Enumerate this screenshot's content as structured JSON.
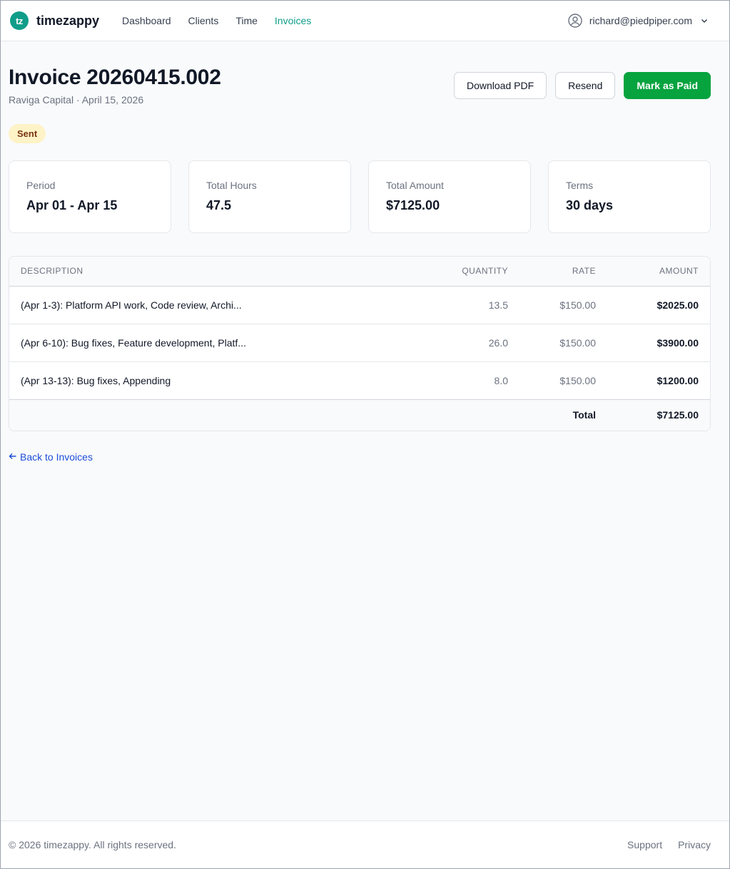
{
  "app": {
    "logo_text": "tz",
    "brand": "timezappy",
    "nav": [
      {
        "label": "Dashboard",
        "active": false
      },
      {
        "label": "Clients",
        "active": false
      },
      {
        "label": "Time",
        "active": false
      },
      {
        "label": "Invoices",
        "active": true
      }
    ],
    "user_email": "richard@piedpiper.com",
    "accent_color": "#0f9d8a"
  },
  "invoice": {
    "title": "Invoice 20260415.002",
    "subtitle": "Raviga Capital · April 15, 2026",
    "status": "Sent",
    "actions": {
      "download": "Download PDF",
      "resend": "Resend",
      "mark_paid": "Mark as Paid"
    }
  },
  "stats": [
    {
      "label": "Period",
      "value": "Apr 01 - Apr 15"
    },
    {
      "label": "Total Hours",
      "value": "47.5"
    },
    {
      "label": "Total Amount",
      "value": "$7125.00"
    },
    {
      "label": "Terms",
      "value": "30 days"
    }
  ],
  "table": {
    "headers": {
      "description": "DESCRIPTION",
      "quantity": "QUANTITY",
      "rate": "RATE",
      "amount": "AMOUNT"
    },
    "rows": [
      {
        "description": "(Apr 1-3): Platform API work, Code review, Archi...",
        "quantity": "13.5",
        "rate": "$150.00",
        "amount": "$2025.00"
      },
      {
        "description": "(Apr 6-10): Bug fixes, Feature development, Platf...",
        "quantity": "26.0",
        "rate": "$150.00",
        "amount": "$3900.00"
      },
      {
        "description": "(Apr 13-13): Bug fixes, Appending",
        "quantity": "8.0",
        "rate": "$150.00",
        "amount": "$1200.00"
      }
    ],
    "total_label": "Total",
    "total_value": "$7125.00"
  },
  "back_link": "Back to Invoices",
  "footer": {
    "copyright": "© 2026 timezappy. All rights reserved.",
    "links": [
      "Support",
      "Privacy"
    ]
  }
}
